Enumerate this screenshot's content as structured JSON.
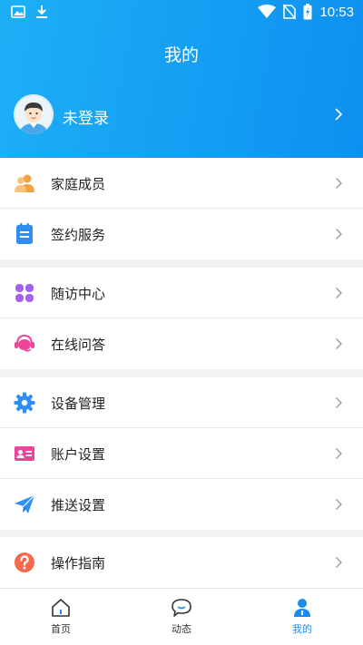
{
  "status_bar": {
    "time": "10:53"
  },
  "header": {
    "title": "我的"
  },
  "profile": {
    "name": "未登录"
  },
  "menu_groups": [
    [
      {
        "label": "家庭成员",
        "icon": "family-members-icon",
        "color": "#f5a13c"
      },
      {
        "label": "签约服务",
        "icon": "contract-service-icon",
        "color": "#2f8ef2"
      }
    ],
    [
      {
        "label": "随访中心",
        "icon": "follow-up-center-icon",
        "color": "#a462f0"
      },
      {
        "label": "在线问答",
        "icon": "online-qa-icon",
        "color": "#f0449b"
      }
    ],
    [
      {
        "label": "设备管理",
        "icon": "gear-icon",
        "color": "#2f8ef2"
      },
      {
        "label": "账户设置",
        "icon": "id-card-icon",
        "color": "#f0449b"
      },
      {
        "label": "推送设置",
        "icon": "paper-plane-icon",
        "color": "#2f8ef2"
      }
    ],
    [
      {
        "label": "操作指南",
        "icon": "question-mark-icon",
        "color": "#f56a4e"
      }
    ]
  ],
  "tabbar": {
    "items": [
      {
        "label": "首页",
        "icon": "home-icon",
        "active": false
      },
      {
        "label": "动态",
        "icon": "chat-bubble-icon",
        "active": false
      },
      {
        "label": "我的",
        "icon": "person-icon",
        "active": true
      }
    ]
  },
  "colors": {
    "header_start": "#1db0f6",
    "header_end": "#0e8ff0",
    "accent": "#1a8cf0"
  }
}
